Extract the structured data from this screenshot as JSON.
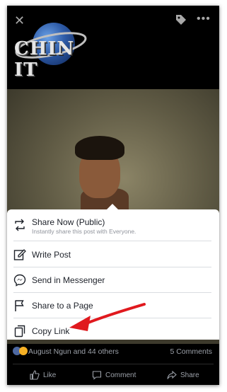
{
  "post": {
    "logo_text": "CHIN IT"
  },
  "share_menu": {
    "items": [
      {
        "label": "Share Now (Public)",
        "sublabel": "Instantly share this post with Everyone.",
        "icon": "repost-icon"
      },
      {
        "label": "Write Post",
        "icon": "compose-icon"
      },
      {
        "label": "Send in Messenger",
        "icon": "messenger-icon"
      },
      {
        "label": "Share to a Page",
        "icon": "flag-icon"
      },
      {
        "label": "Copy Link",
        "icon": "copy-icon"
      }
    ]
  },
  "stats": {
    "reactions_text": "August Ngun and 44 others",
    "comments_text": "5 Comments"
  },
  "actions": {
    "like": "Like",
    "comment": "Comment",
    "share": "Share"
  },
  "colors": {
    "annotation_arrow": "#e0191e",
    "background": "#000000",
    "sheet": "#ffffff",
    "muted_text": "#9ba0a8"
  }
}
